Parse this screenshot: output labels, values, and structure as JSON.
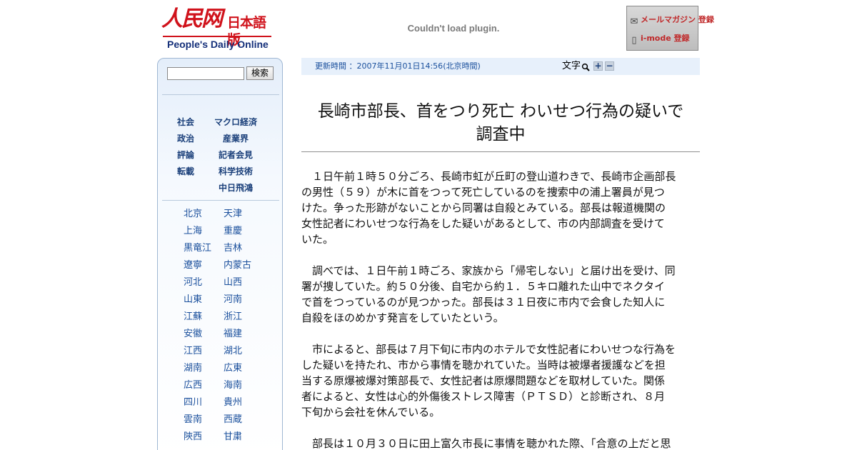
{
  "header": {
    "logo_mark": "人民网",
    "logo_ja": "日本語版",
    "logo_en": "People's Daily Online",
    "plugin_message": "Couldn't load plugin.",
    "promo": {
      "mail_magazine": "メールマガジン 登録",
      "imode": "i-mode 登録"
    }
  },
  "sidebar": {
    "search_button": "検索",
    "search_value": "",
    "categories_left": [
      "社会",
      "政治",
      "評論",
      "転載"
    ],
    "categories_right": [
      "マクロ経済",
      "産業界",
      "記者会見",
      "科学技術",
      "中日飛鴻"
    ],
    "regions": [
      [
        "北京",
        "天津"
      ],
      [
        "上海",
        "重慶"
      ],
      [
        "黒竜江",
        "吉林"
      ],
      [
        "遼寧",
        "内蒙古"
      ],
      [
        "河北",
        "山西"
      ],
      [
        "山東",
        "河南"
      ],
      [
        "江蘇",
        "浙江"
      ],
      [
        "安徽",
        "福建"
      ],
      [
        "江西",
        "湖北"
      ],
      [
        "湖南",
        "広東"
      ],
      [
        "広西",
        "海南"
      ],
      [
        "四川",
        "貴州"
      ],
      [
        "雲南",
        "西蔵"
      ],
      [
        "陝西",
        "甘粛"
      ]
    ]
  },
  "info_bar": {
    "update_label": "更新時間 ：2007年11月01日14:56",
    "timezone": "(北京時間)",
    "font_size_label": "文字",
    "plus": "+",
    "minus": "−"
  },
  "article": {
    "headline_line1": "長崎市部長、首をつり死亡 わいせつ行為の疑いで",
    "headline_line2": "調査中",
    "paragraphs": [
      "　１日午前１時５０分ごろ、長崎市虹が丘町の登山道わきで、長崎市企画部長\nの男性（５９）が木に首をつって死亡しているのを捜索中の浦上署員が見つ\nけた。争った形跡がないことから同署は自殺とみている。部長は報道機関の\n女性記者にわいせつな行為をした疑いがあるとして、市の内部調査を受けて\nいた。",
      "　調べでは、１日午前１時ごろ、家族から「帰宅しない」と届け出を受け、同\n署が捜していた。約５０分後、自宅から約１．５キロ離れた山中でネクタイ\nで首をつっているのが見つかった。部長は３１日夜に市内で会食した知人に\n自殺をほのめかす発言をしていたという。",
      "　市によると、部長は７月下旬に市内のホテルで女性記者にわいせつな行為を\nした疑いを持たれ、市から事情を聴かれていた。当時は被爆者援護などを担\n当する原爆被爆対策部長で、女性記者は原爆問題などを取材していた。関係\n者によると、女性は心的外傷後ストレス障害（ＰＴＳＤ）と診断され、８月\n下旬から会社を休んでいる。",
      "　部長は１０月３０日に田上富久市長に事情を聴かれた際、「合意の上だと思"
    ]
  }
}
